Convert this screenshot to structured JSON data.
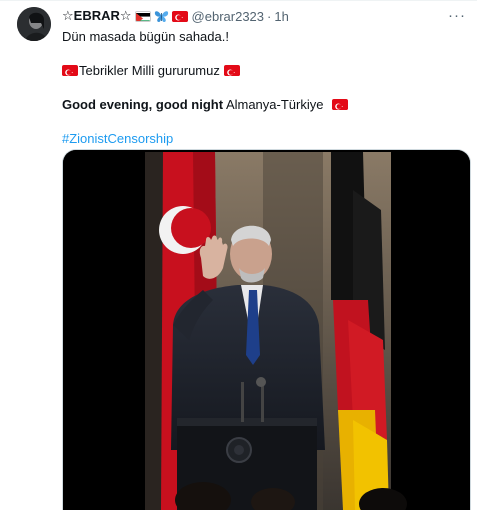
{
  "tweet": {
    "display_name": "☆EBRAR☆",
    "handle": "@ebrar2323",
    "separator": "·",
    "time": "1h",
    "more_label": "···",
    "lines": {
      "line1": "Dün masada bügün sahada.!",
      "line2": "Tebrikler Milli gururumuz",
      "line3_bold": "Good evening, good night",
      "line3_rest": " Almanya-Türkiye",
      "hashtag": "#ZionistCensorship"
    }
  },
  "icons": {
    "name_badges": [
      "palestine-flag-icon",
      "butterfly-icon",
      "turkey-flag-icon"
    ],
    "more": "more-options-icon"
  },
  "colors": {
    "link": "#1d9bf0",
    "secondary_text": "#536471",
    "turkey_red": "#e30a17"
  }
}
